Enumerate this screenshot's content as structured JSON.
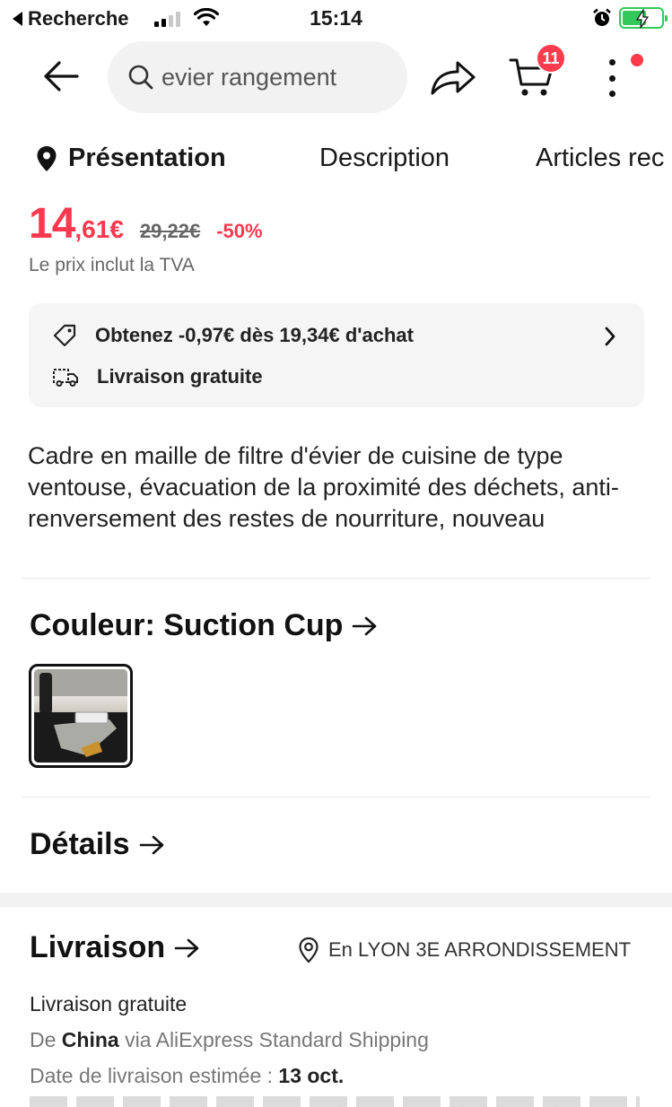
{
  "status_bar": {
    "back_label": "Recherche",
    "time": "15:14"
  },
  "topnav": {
    "search_query": "evier rangement",
    "cart_count": "11"
  },
  "tabs": [
    {
      "label": "Présentation",
      "active": true
    },
    {
      "label": "Description"
    },
    {
      "label": "Articles rec"
    }
  ],
  "price": {
    "integer": "14",
    "decimal": ",61€",
    "original": "29,22€",
    "discount": "-50%",
    "vat_note": "Le prix inclut la TVA"
  },
  "promo": {
    "coupon": "Obtenez -0,97€ dès 19,34€ d'achat",
    "shipping": "Livraison gratuite"
  },
  "product": {
    "title": "Cadre en maille de filtre d'évier de cuisine de type ventouse, évacuation de la proximité des déchets, anti-renversement des restes de nourriture, nouveau"
  },
  "color_section": {
    "heading": "Couleur: Suction Cup"
  },
  "details_section": {
    "heading": "Détails"
  },
  "delivery": {
    "heading": "Livraison",
    "location": "En LYON 3E ARRONDISSEMENT",
    "free": "Livraison gratuite",
    "from_prefix": "De",
    "from_country": "China",
    "via": "via AliExpress Standard Shipping",
    "estimate_label": "Date de livraison estimée :",
    "estimate_date": "13 oct."
  },
  "colors": {
    "accent": "#fd384f",
    "battery": "#34c759",
    "badge": "#ff3b4d"
  }
}
